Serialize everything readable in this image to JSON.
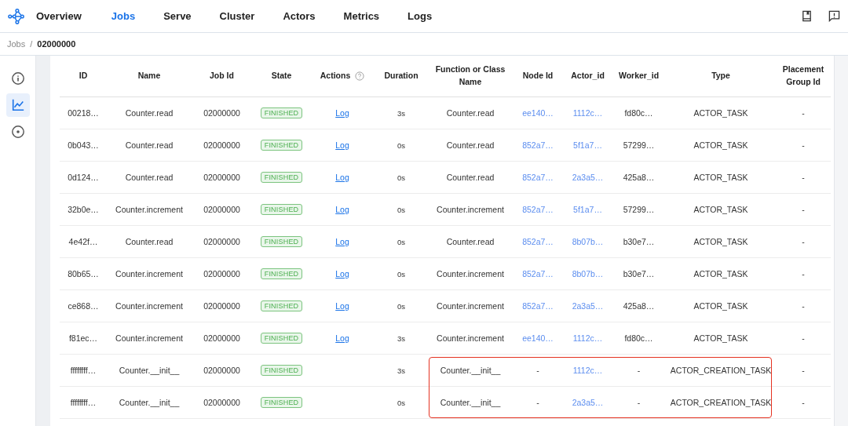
{
  "nav": {
    "tabs": [
      {
        "label": "Overview",
        "selected": false
      },
      {
        "label": "Jobs",
        "selected": true
      },
      {
        "label": "Serve",
        "selected": false
      },
      {
        "label": "Cluster",
        "selected": false
      },
      {
        "label": "Actors",
        "selected": false
      },
      {
        "label": "Metrics",
        "selected": false
      },
      {
        "label": "Logs",
        "selected": false
      }
    ]
  },
  "breadcrumb": {
    "parent": "Jobs",
    "separator": "/",
    "current": "02000000"
  },
  "sidebar": {
    "items": [
      {
        "kind": "info",
        "selected": false
      },
      {
        "kind": "chart",
        "selected": true
      },
      {
        "kind": "target",
        "selected": false
      }
    ]
  },
  "table": {
    "columns": [
      "ID",
      "Name",
      "Job Id",
      "State",
      "Actions",
      "Duration",
      "Function or Class Name",
      "Node Id",
      "Actor_id",
      "Worker_id",
      "Type",
      "Placement Group Id"
    ],
    "rows": [
      {
        "id": "00218…",
        "name": "Counter.read",
        "job_id": "02000000",
        "state": "FINISHED",
        "action": "Log",
        "duration": "3s",
        "function": "Counter.read",
        "node_id": {
          "text": "ee140…",
          "link": true
        },
        "actor_id": {
          "text": "1112c…",
          "link": true
        },
        "worker_id": "fd80c…",
        "type": "ACTOR_TASK",
        "placement_group_id": "-",
        "highlighted": false
      },
      {
        "id": "0b043…",
        "name": "Counter.read",
        "job_id": "02000000",
        "state": "FINISHED",
        "action": "Log",
        "duration": "0s",
        "function": "Counter.read",
        "node_id": {
          "text": "852a7…",
          "link": true
        },
        "actor_id": {
          "text": "5f1a7…",
          "link": true
        },
        "worker_id": "57299…",
        "type": "ACTOR_TASK",
        "placement_group_id": "-",
        "highlighted": false
      },
      {
        "id": "0d124…",
        "name": "Counter.read",
        "job_id": "02000000",
        "state": "FINISHED",
        "action": "Log",
        "duration": "0s",
        "function": "Counter.read",
        "node_id": {
          "text": "852a7…",
          "link": true
        },
        "actor_id": {
          "text": "2a3a5…",
          "link": true
        },
        "worker_id": "425a8…",
        "type": "ACTOR_TASK",
        "placement_group_id": "-",
        "highlighted": false
      },
      {
        "id": "32b0e…",
        "name": "Counter.increment",
        "job_id": "02000000",
        "state": "FINISHED",
        "action": "Log",
        "duration": "0s",
        "function": "Counter.increment",
        "node_id": {
          "text": "852a7…",
          "link": true
        },
        "actor_id": {
          "text": "5f1a7…",
          "link": true
        },
        "worker_id": "57299…",
        "type": "ACTOR_TASK",
        "placement_group_id": "-",
        "highlighted": false
      },
      {
        "id": "4e42f…",
        "name": "Counter.read",
        "job_id": "02000000",
        "state": "FINISHED",
        "action": "Log",
        "duration": "0s",
        "function": "Counter.read",
        "node_id": {
          "text": "852a7…",
          "link": true
        },
        "actor_id": {
          "text": "8b07b…",
          "link": true
        },
        "worker_id": "b30e7…",
        "type": "ACTOR_TASK",
        "placement_group_id": "-",
        "highlighted": false
      },
      {
        "id": "80b65…",
        "name": "Counter.increment",
        "job_id": "02000000",
        "state": "FINISHED",
        "action": "Log",
        "duration": "0s",
        "function": "Counter.increment",
        "node_id": {
          "text": "852a7…",
          "link": true
        },
        "actor_id": {
          "text": "8b07b…",
          "link": true
        },
        "worker_id": "b30e7…",
        "type": "ACTOR_TASK",
        "placement_group_id": "-",
        "highlighted": false
      },
      {
        "id": "ce868…",
        "name": "Counter.increment",
        "job_id": "02000000",
        "state": "FINISHED",
        "action": "Log",
        "duration": "0s",
        "function": "Counter.increment",
        "node_id": {
          "text": "852a7…",
          "link": true
        },
        "actor_id": {
          "text": "2a3a5…",
          "link": true
        },
        "worker_id": "425a8…",
        "type": "ACTOR_TASK",
        "placement_group_id": "-",
        "highlighted": false
      },
      {
        "id": "f81ec…",
        "name": "Counter.increment",
        "job_id": "02000000",
        "state": "FINISHED",
        "action": "Log",
        "duration": "3s",
        "function": "Counter.increment",
        "node_id": {
          "text": "ee140…",
          "link": true
        },
        "actor_id": {
          "text": "1112c…",
          "link": true
        },
        "worker_id": "fd80c…",
        "type": "ACTOR_TASK",
        "placement_group_id": "-",
        "highlighted": false
      },
      {
        "id": "ffffffff…",
        "name": "Counter.__init__",
        "job_id": "02000000",
        "state": "FINISHED",
        "duration": "3s",
        "function": "Counter.__init__",
        "node_id": {
          "text": "-",
          "link": false
        },
        "actor_id": {
          "text": "1112c…",
          "link": true
        },
        "worker_id": "-",
        "type": "ACTOR_CREATION_TASK",
        "placement_group_id": "-",
        "highlighted": true
      },
      {
        "id": "ffffffff…",
        "name": "Counter.__init__",
        "job_id": "02000000",
        "state": "FINISHED",
        "duration": "0s",
        "function": "Counter.__init__",
        "node_id": {
          "text": "-",
          "link": false
        },
        "actor_id": {
          "text": "2a3a5…",
          "link": true
        },
        "worker_id": "-",
        "type": "ACTOR_CREATION_TASK",
        "placement_group_id": "-",
        "highlighted": true
      }
    ]
  }
}
